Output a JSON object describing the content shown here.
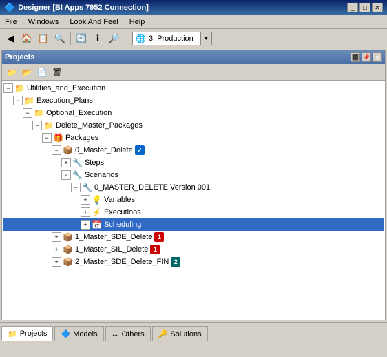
{
  "titleBar": {
    "icon": "🔷",
    "title": "Designer [BI Apps 7952 Connection]",
    "minimizeLabel": "_",
    "maximizeLabel": "□",
    "closeLabel": "✕"
  },
  "menuBar": {
    "items": [
      {
        "label": "File",
        "id": "file"
      },
      {
        "label": "Windows",
        "id": "windows"
      },
      {
        "label": "Look And Feel",
        "id": "look-and-feel"
      },
      {
        "label": "Help",
        "id": "help"
      }
    ]
  },
  "toolbar": {
    "buttons": [
      {
        "icon": "◀",
        "name": "back-btn"
      },
      {
        "icon": "🏠",
        "name": "home-btn"
      },
      {
        "icon": "📋",
        "name": "clipboard-btn"
      },
      {
        "icon": "🔍",
        "name": "search-btn"
      },
      {
        "icon": "🔄",
        "name": "refresh-btn"
      },
      {
        "icon": "ℹ",
        "name": "info-btn"
      },
      {
        "icon": "🔎",
        "name": "find-btn"
      }
    ],
    "environment": {
      "icon": "🌐",
      "value": "3. Production",
      "dropdownArrow": "▼"
    }
  },
  "projectsPanel": {
    "title": "Projects",
    "controls": [
      {
        "label": "⬛",
        "name": "minimize-panel"
      },
      {
        "label": "📌",
        "name": "pin-panel"
      },
      {
        "label": "✕",
        "name": "close-panel"
      }
    ],
    "toolbarButtons": [
      {
        "icon": "📁",
        "name": "new-folder-btn"
      },
      {
        "icon": "📂",
        "name": "open-folder-btn"
      },
      {
        "icon": "📄",
        "name": "new-file-btn"
      },
      {
        "icon": "🗑",
        "name": "delete-btn"
      }
    ],
    "tree": [
      {
        "id": "root",
        "indent": 0,
        "expanded": true,
        "icon": "📁",
        "label": "Utilities_and_Execution",
        "badge": null
      },
      {
        "id": "execution-plans",
        "indent": 1,
        "expanded": true,
        "icon": "📁",
        "label": "Execution_Plans",
        "badge": null
      },
      {
        "id": "optional-execution",
        "indent": 2,
        "expanded": true,
        "icon": "📁",
        "label": "Optional_Execution",
        "badge": null
      },
      {
        "id": "delete-master",
        "indent": 3,
        "expanded": true,
        "icon": "📁",
        "label": "Delete_Master_Packages",
        "badge": null
      },
      {
        "id": "packages",
        "indent": 4,
        "expanded": true,
        "icon": "🎁",
        "label": "Packages",
        "badge": null
      },
      {
        "id": "master-delete",
        "indent": 5,
        "expanded": true,
        "icon": "📦",
        "label": "0_Master_Delete",
        "badge": "blue",
        "badgeText": "✓"
      },
      {
        "id": "steps",
        "indent": 6,
        "expanded": false,
        "icon": "🔧",
        "label": "Steps",
        "badge": null
      },
      {
        "id": "scenarios",
        "indent": 6,
        "expanded": true,
        "icon": "🔧",
        "label": "Scenarios",
        "badge": null
      },
      {
        "id": "master-delete-version",
        "indent": 7,
        "expanded": true,
        "icon": "🔧",
        "label": "0_MASTER_DELETE Version 001",
        "badge": null
      },
      {
        "id": "variables",
        "indent": 8,
        "expanded": false,
        "icon": "💡",
        "label": "Variables",
        "badge": null
      },
      {
        "id": "executions",
        "indent": 8,
        "expanded": false,
        "icon": "⚡",
        "label": "Executions",
        "badge": null
      },
      {
        "id": "scheduling",
        "indent": 8,
        "expanded": false,
        "icon": "📅",
        "label": "Scheduling",
        "badge": null,
        "selected": true
      },
      {
        "id": "master-sde-delete",
        "indent": 5,
        "expanded": false,
        "icon": "📦",
        "label": "1_Master_SDE_Delete",
        "badge": "red",
        "badgeText": "1"
      },
      {
        "id": "master-sil-delete",
        "indent": 5,
        "expanded": false,
        "icon": "📦",
        "label": "1_Master_SIL_Delete",
        "badge": "red",
        "badgeText": "1"
      },
      {
        "id": "master-sde-delete-fin",
        "indent": 5,
        "expanded": false,
        "icon": "📦",
        "label": "2_Master_SDE_Delete_FIN",
        "badge": "teal",
        "badgeText": "2"
      }
    ]
  },
  "tabBar": {
    "tabs": [
      {
        "label": "Projects",
        "icon": "📁",
        "active": true,
        "id": "projects-tab"
      },
      {
        "label": "Models",
        "icon": "🔷",
        "active": false,
        "id": "models-tab"
      },
      {
        "label": "Others",
        "icon": "↔",
        "active": false,
        "id": "others-tab"
      },
      {
        "label": "Solutions",
        "icon": "🔑",
        "active": false,
        "id": "solutions-tab"
      }
    ]
  }
}
